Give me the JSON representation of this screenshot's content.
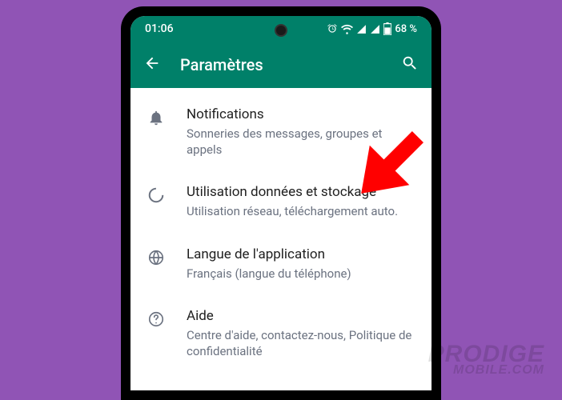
{
  "status_bar": {
    "time": "01:06",
    "battery_text": "68 %"
  },
  "app_bar": {
    "title": "Paramètres"
  },
  "settings": [
    {
      "icon": "bell",
      "title": "Notifications",
      "subtitle": "Sonneries des messages, groupes et appels"
    },
    {
      "icon": "data-usage",
      "title": "Utilisation données et stockage",
      "subtitle": "Utilisation réseau, téléchargement auto."
    },
    {
      "icon": "globe",
      "title": "Langue de l'application",
      "subtitle": "Français (langue du téléphone)"
    },
    {
      "icon": "help",
      "title": "Aide",
      "subtitle": "Centre d'aide, contactez-nous, Politique de confidentialité"
    }
  ],
  "watermark": {
    "line1": "PRODIGE",
    "line2": "MOBILE.COM"
  }
}
